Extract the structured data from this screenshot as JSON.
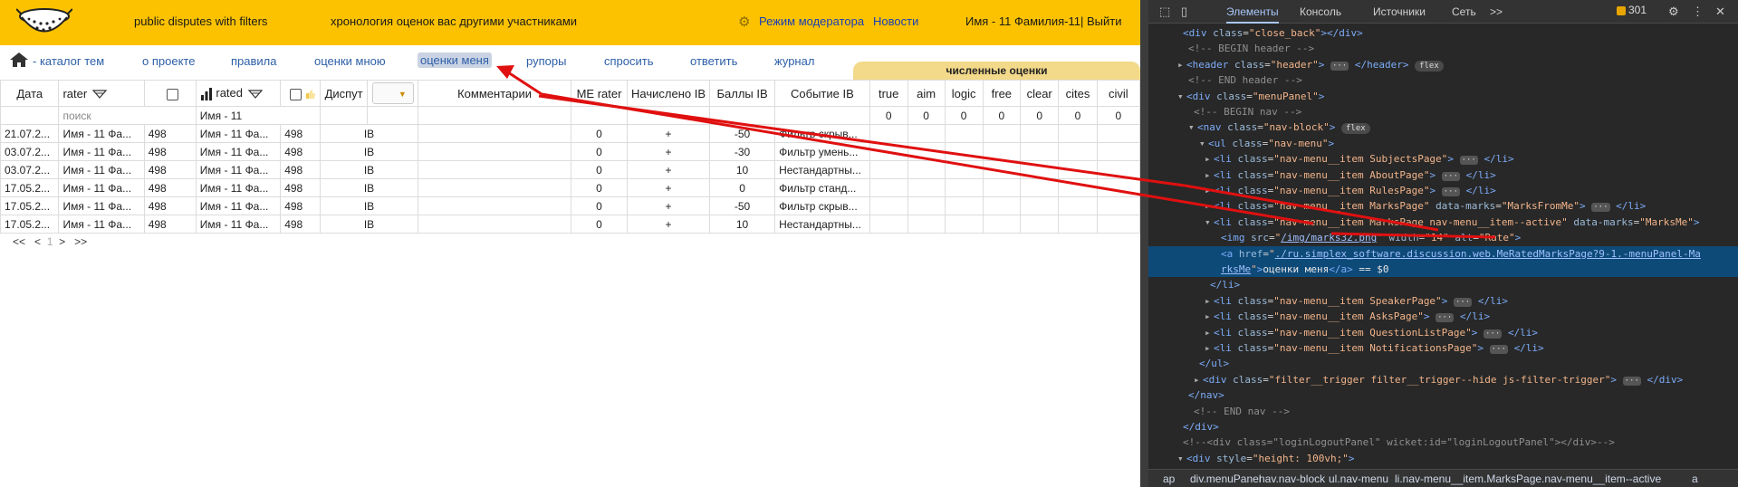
{
  "topbar": {
    "site_name": "public disputes with filters",
    "site_sub": "хронология оценок вас другими участниками",
    "moderator": "Режим модератора",
    "news": "Новости",
    "user": "Имя - 11 Фамилия-11| Выйти",
    "bg": "#fcc200"
  },
  "nav": {
    "items": [
      {
        "label": "- каталог тем"
      },
      {
        "label": "о проекте"
      },
      {
        "label": "правила"
      },
      {
        "label": "оценки мною"
      },
      {
        "label": "оценки меня"
      },
      {
        "label": "рупоры"
      },
      {
        "label": "спросить"
      },
      {
        "label": "ответить"
      },
      {
        "label": "журнал"
      }
    ],
    "active_index": 4
  },
  "table": {
    "group_header": "численные оценки",
    "headers": {
      "date": "Дата",
      "rater": "rater",
      "rated": "rated",
      "dispute": "Диспут",
      "comments": "Комментарии",
      "me_rater": "ME rater",
      "accrued": "Начислено IB",
      "points": "Баллы IB",
      "event": "Событие IB",
      "true": "true",
      "aim": "aim",
      "logic": "logic",
      "free": "free",
      "clear": "clear",
      "cites": "cites",
      "civil": "civil"
    },
    "filter": {
      "search_placeholder": "поиск",
      "rated_value": "Имя - 11",
      "zeros": [
        "0",
        "0",
        "0",
        "0",
        "0",
        "0",
        "0"
      ]
    },
    "rows": [
      {
        "date": "21.07.2...",
        "rater": "Имя - 11 Фа...",
        "rn": "498",
        "rated": "Имя - 11 Фа...",
        "rdn": "498",
        "dispute": "IB",
        "me": "0",
        "acc": "+",
        "pts": "-50",
        "event": "Фильтр скрыв..."
      },
      {
        "date": "03.07.2...",
        "rater": "Имя - 11 Фа...",
        "rn": "498",
        "rated": "Имя - 11 Фа...",
        "rdn": "498",
        "dispute": "IB",
        "me": "0",
        "acc": "+",
        "pts": "-30",
        "event": "Фильтр умень..."
      },
      {
        "date": "03.07.2...",
        "rater": "Имя - 11 Фа...",
        "rn": "498",
        "rated": "Имя - 11 Фа...",
        "rdn": "498",
        "dispute": "IB",
        "me": "0",
        "acc": "+",
        "pts": "10",
        "event": "Нестандартны..."
      },
      {
        "date": "17.05.2...",
        "rater": "Имя - 11 Фа...",
        "rn": "498",
        "rated": "Имя - 11 Фа...",
        "rdn": "498",
        "dispute": "IB",
        "me": "0",
        "acc": "+",
        "pts": "0",
        "event": "Фильтр станд..."
      },
      {
        "date": "17.05.2...",
        "rater": "Имя - 11 Фа...",
        "rn": "498",
        "rated": "Имя - 11 Фа...",
        "rdn": "498",
        "dispute": "IB",
        "me": "0",
        "acc": "+",
        "pts": "-50",
        "event": "Фильтр скрыв..."
      },
      {
        "date": "17.05.2...",
        "rater": "Имя - 11 Фа...",
        "rn": "498",
        "rated": "Имя - 11 Фа...",
        "rdn": "498",
        "dispute": "IB",
        "me": "0",
        "acc": "+",
        "pts": "10",
        "event": "Нестандартны..."
      }
    ]
  },
  "pager": {
    "first": "<<",
    "prev": "<",
    "current": "1",
    "next": ">",
    "last": ">>"
  },
  "devtools": {
    "tabs": [
      "Элементы",
      "Консоль",
      "Источники",
      "Сеть"
    ],
    "more": ">>",
    "issues_count": "301",
    "crumbs": [
      "ap",
      "div.menuPanel",
      "nav.nav-block",
      "ul.nav-menu",
      "li.nav-menu__item.MarksPage.nav-menu__item--active",
      "a"
    ]
  },
  "dom_lines": [
    {
      "html": "<span class=\"tg\">&lt;div</span> <span class=\"at\">class</span>=<span class=\"av\">\"close_back\"</span><span class=\"tg\">&gt;&lt;/div&gt;</span>"
    },
    {
      "html": "<span class=\"cm\">&lt;!-- BEGIN header --&gt;</span>"
    },
    {
      "html": "<span class=\"tri\">▸</span><span class=\"tg\">&lt;header</span> <span class=\"at\">class</span>=<span class=\"av\">\"header\"</span><span class=\"tg\">&gt;</span> <span class=\"ell\">···</span> <span class=\"tg\">&lt;/header&gt;</span> <span class=\"pill\">flex</span>"
    },
    {
      "html": "<span class=\"cm\">&lt;!-- END header --&gt;</span>"
    },
    {
      "html": "<span class=\"tri\">▾</span><span class=\"tg\">&lt;div</span> <span class=\"at\">class</span>=<span class=\"av\">\"menuPanel\"</span><span class=\"tg\">&gt;</span>"
    },
    {
      "html": "<span class=\"cm\">&lt;!-- BEGIN nav --&gt;</span>"
    },
    {
      "html": "<span class=\"tri\">▾</span><span class=\"tg\">&lt;nav</span> <span class=\"at\">class</span>=<span class=\"av\">\"nav-block\"</span><span class=\"tg\">&gt;</span> <span class=\"pill\">flex</span>"
    },
    {
      "html": "<span class=\"tri\">▾</span><span class=\"tg\">&lt;ul</span> <span class=\"at\">class</span>=<span class=\"av\">\"nav-menu\"</span><span class=\"tg\">&gt;</span>"
    },
    {
      "html": "<span class=\"tri\">▸</span><span class=\"tg\">&lt;li</span> <span class=\"at\">class</span>=<span class=\"av\">\"nav-menu__item SubjectsPage\"</span><span class=\"tg\">&gt;</span> <span class=\"ell\">···</span> <span class=\"tg\">&lt;/li&gt;</span>"
    },
    {
      "html": "<span class=\"tri\">▸</span><span class=\"tg\">&lt;li</span> <span class=\"at\">class</span>=<span class=\"av\">\"nav-menu__item AboutPage\"</span><span class=\"tg\">&gt;</span> <span class=\"ell\">···</span> <span class=\"tg\">&lt;/li&gt;</span>"
    },
    {
      "html": "<span class=\"tri\">▸</span><span class=\"tg\">&lt;li</span> <span class=\"at\">class</span>=<span class=\"av\">\"nav-menu__item RulesPage\"</span><span class=\"tg\">&gt;</span> <span class=\"ell\">···</span> <span class=\"tg\">&lt;/li&gt;</span>"
    },
    {
      "html": "<span class=\"tri\">▸</span><span class=\"tg\">&lt;li</span> <span class=\"at\">class</span>=<span class=\"av\">\"nav-menu__item MarksPage\"</span> <span class=\"at\">data-marks</span>=<span class=\"av\">\"MarksFromMe\"</span><span class=\"tg\">&gt;</span> <span class=\"ell\">···</span> <span class=\"tg\">&lt;/li&gt;</span>"
    },
    {
      "html": "<span class=\"tri\">▾</span><span class=\"tg\">&lt;li</span> <span class=\"at\">class</span>=<span class=\"av\">\"nav-menu__item MarksPage nav-menu__item--active\"</span> <span class=\"at\">data-marks</span>=<span class=\"av\">\"MarksMe\"</span><span class=\"tg\">&gt;</span>"
    },
    {
      "html": "<span class=\"tg\">&lt;img</span> <span class=\"at\">src</span>=<span class=\"av\">\"<span class=\"link\">/img/marks32.png</span>\"</span> <span class=\"at\">width</span>=<span class=\"av\">\"14\"</span> <span class=\"at\">alt</span>=<span class=\"av\">\"Rate\"</span><span class=\"tg\">&gt;</span>"
    },
    {
      "html": "<span class=\"tg\">&lt;a</span> <span class=\"at\">href</span>=<span class=\"av\">\"<span class=\"link\">./ru.simplex_software.discussion.web.MeRatedMarksPage?9-1.-menuPanel-Ma</span></span>"
    },
    {
      "html": "<span class=\"av\"><span class=\"link\">rksMe</span>\"</span><span class=\"tg\">&gt;</span><span class=\"tx\">оценки меня</span><span class=\"tg\">&lt;/a&gt;</span> <span class=\"tx\">== $0</span>"
    },
    {
      "html": "<span class=\"tg\">&lt;/li&gt;</span>"
    },
    {
      "html": "<span class=\"tri\">▸</span><span class=\"tg\">&lt;li</span> <span class=\"at\">class</span>=<span class=\"av\">\"nav-menu__item SpeakerPage\"</span><span class=\"tg\">&gt;</span> <span class=\"ell\">···</span> <span class=\"tg\">&lt;/li&gt;</span>"
    },
    {
      "html": "<span class=\"tri\">▸</span><span class=\"tg\">&lt;li</span> <span class=\"at\">class</span>=<span class=\"av\">\"nav-menu__item AsksPage\"</span><span class=\"tg\">&gt;</span> <span class=\"ell\">···</span> <span class=\"tg\">&lt;/li&gt;</span>"
    },
    {
      "html": "<span class=\"tri\">▸</span><span class=\"tg\">&lt;li</span> <span class=\"at\">class</span>=<span class=\"av\">\"nav-menu__item QuestionListPage\"</span><span class=\"tg\">&gt;</span> <span class=\"ell\">···</span> <span class=\"tg\">&lt;/li&gt;</span>"
    },
    {
      "html": "<span class=\"tri\">▸</span><span class=\"tg\">&lt;li</span> <span class=\"at\">class</span>=<span class=\"av\">\"nav-menu__item NotificationsPage\"</span><span class=\"tg\">&gt;</span> <span class=\"ell\">···</span> <span class=\"tg\">&lt;/li&gt;</span>"
    },
    {
      "html": "<span class=\"tg\">&lt;/ul&gt;</span>"
    },
    {
      "html": "<span class=\"tri\">▸</span><span class=\"tg\">&lt;div</span> <span class=\"at\">class</span>=<span class=\"av\">\"filter__trigger filter__trigger--hide js-filter-trigger\"</span><span class=\"tg\">&gt;</span> <span class=\"ell\">···</span> <span class=\"tg\">&lt;/div&gt;</span>"
    },
    {
      "html": "<span class=\"tg\">&lt;/nav&gt;</span>"
    },
    {
      "html": "<span class=\"cm\">&lt;!-- END nav --&gt;</span>"
    },
    {
      "html": "<span class=\"tg\">&lt;/div&gt;</span>"
    },
    {
      "html": "<span class=\"cm\">&lt;!--&lt;div class=\"loginLogoutPanel\" wicket:id=\"loginLogoutPanel\"&gt;&lt;/div&gt;--&gt;</span>"
    },
    {
      "html": "<span class=\"tri\">▾</span><span class=\"tg\">&lt;div</span> <span class=\"at\">style</span>=<span class=\"av\">\"height: 100vh;\"</span><span class=\"tg\">&gt;</span>"
    }
  ]
}
